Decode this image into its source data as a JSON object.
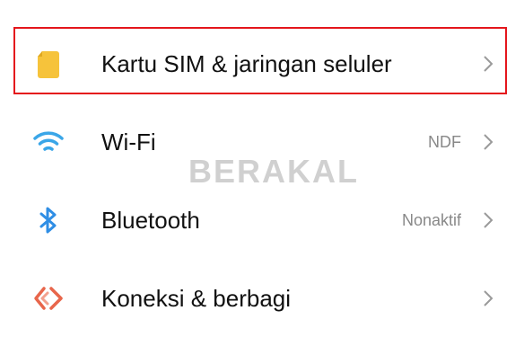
{
  "settings": {
    "items": [
      {
        "label": "Kartu SIM & jaringan seluler",
        "value": "",
        "icon": "sim-card-icon",
        "icon_color": "#F6C33B"
      },
      {
        "label": "Wi-Fi",
        "value": "NDF",
        "icon": "wifi-icon",
        "icon_color": "#3AA6E8"
      },
      {
        "label": "Bluetooth",
        "value": "Nonaktif",
        "icon": "bluetooth-icon",
        "icon_color": "#2F8EE5"
      },
      {
        "label": "Koneksi & berbagi",
        "value": "",
        "icon": "connection-sharing-icon",
        "icon_color": "#E8664B"
      }
    ],
    "highlight_color": "#E4161C"
  },
  "watermark": "BERAKAL"
}
